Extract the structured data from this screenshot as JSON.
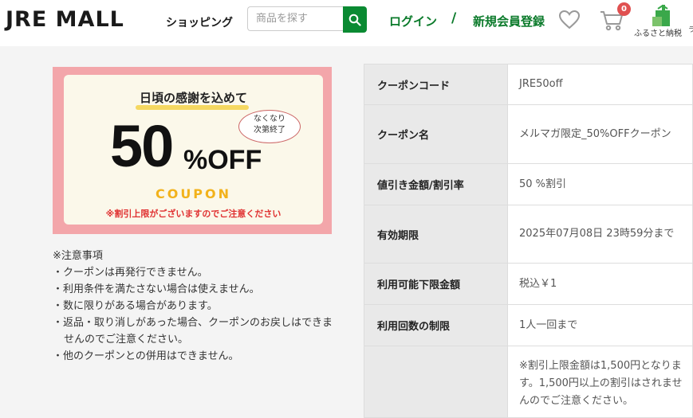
{
  "header": {
    "logo": "JRE MALL",
    "logo_sub": "ショッピング",
    "search_placeholder": "商品を探す",
    "login": "ログイン",
    "separator": "/",
    "register": "新規会員登録",
    "cart_count": "0",
    "furusato_label": "ふるさと納税",
    "edge_text": "ラ"
  },
  "banner": {
    "headline": "日頃の感謝を込めて",
    "percent": "50",
    "off": "%OFF",
    "bubble": "なくなり\n次第終了",
    "coupon": "COUPON",
    "note": "※割引上限がございますのでご注意ください"
  },
  "notes": {
    "title": "※注意事項",
    "items": [
      "・クーポンは再発行できません。",
      "・利用条件を満たさない場合は使えません。",
      "・数に限りがある場合があります。",
      "・返品・取り消しがあった場合、クーポンのお戻しはできませんのでご注意ください。",
      "・他のクーポンとの併用はできません。"
    ]
  },
  "details": [
    {
      "key": "クーポンコード",
      "value": "JRE50off"
    },
    {
      "key": "クーポン名",
      "value": "メルマガ限定_50%OFFクーポン"
    },
    {
      "key": "値引き金額/割引率",
      "value": "50 %割引"
    },
    {
      "key": "有効期限",
      "value": "2025年07月08日 23時59分まで"
    },
    {
      "key": "利用可能下限金額",
      "value": "税込￥1"
    },
    {
      "key": "利用回数の制限",
      "value": "1人一回まで"
    },
    {
      "key": "",
      "value": "※割引上限金額は1,500円となります。1,500円以上の割引はされませんのでご注意ください。"
    }
  ],
  "colors": {
    "brand_green": "#0a7a2a",
    "banner_pink": "#f3a6aa",
    "coupon_yellow": "#f2b21b",
    "badge_red": "#e05050"
  }
}
